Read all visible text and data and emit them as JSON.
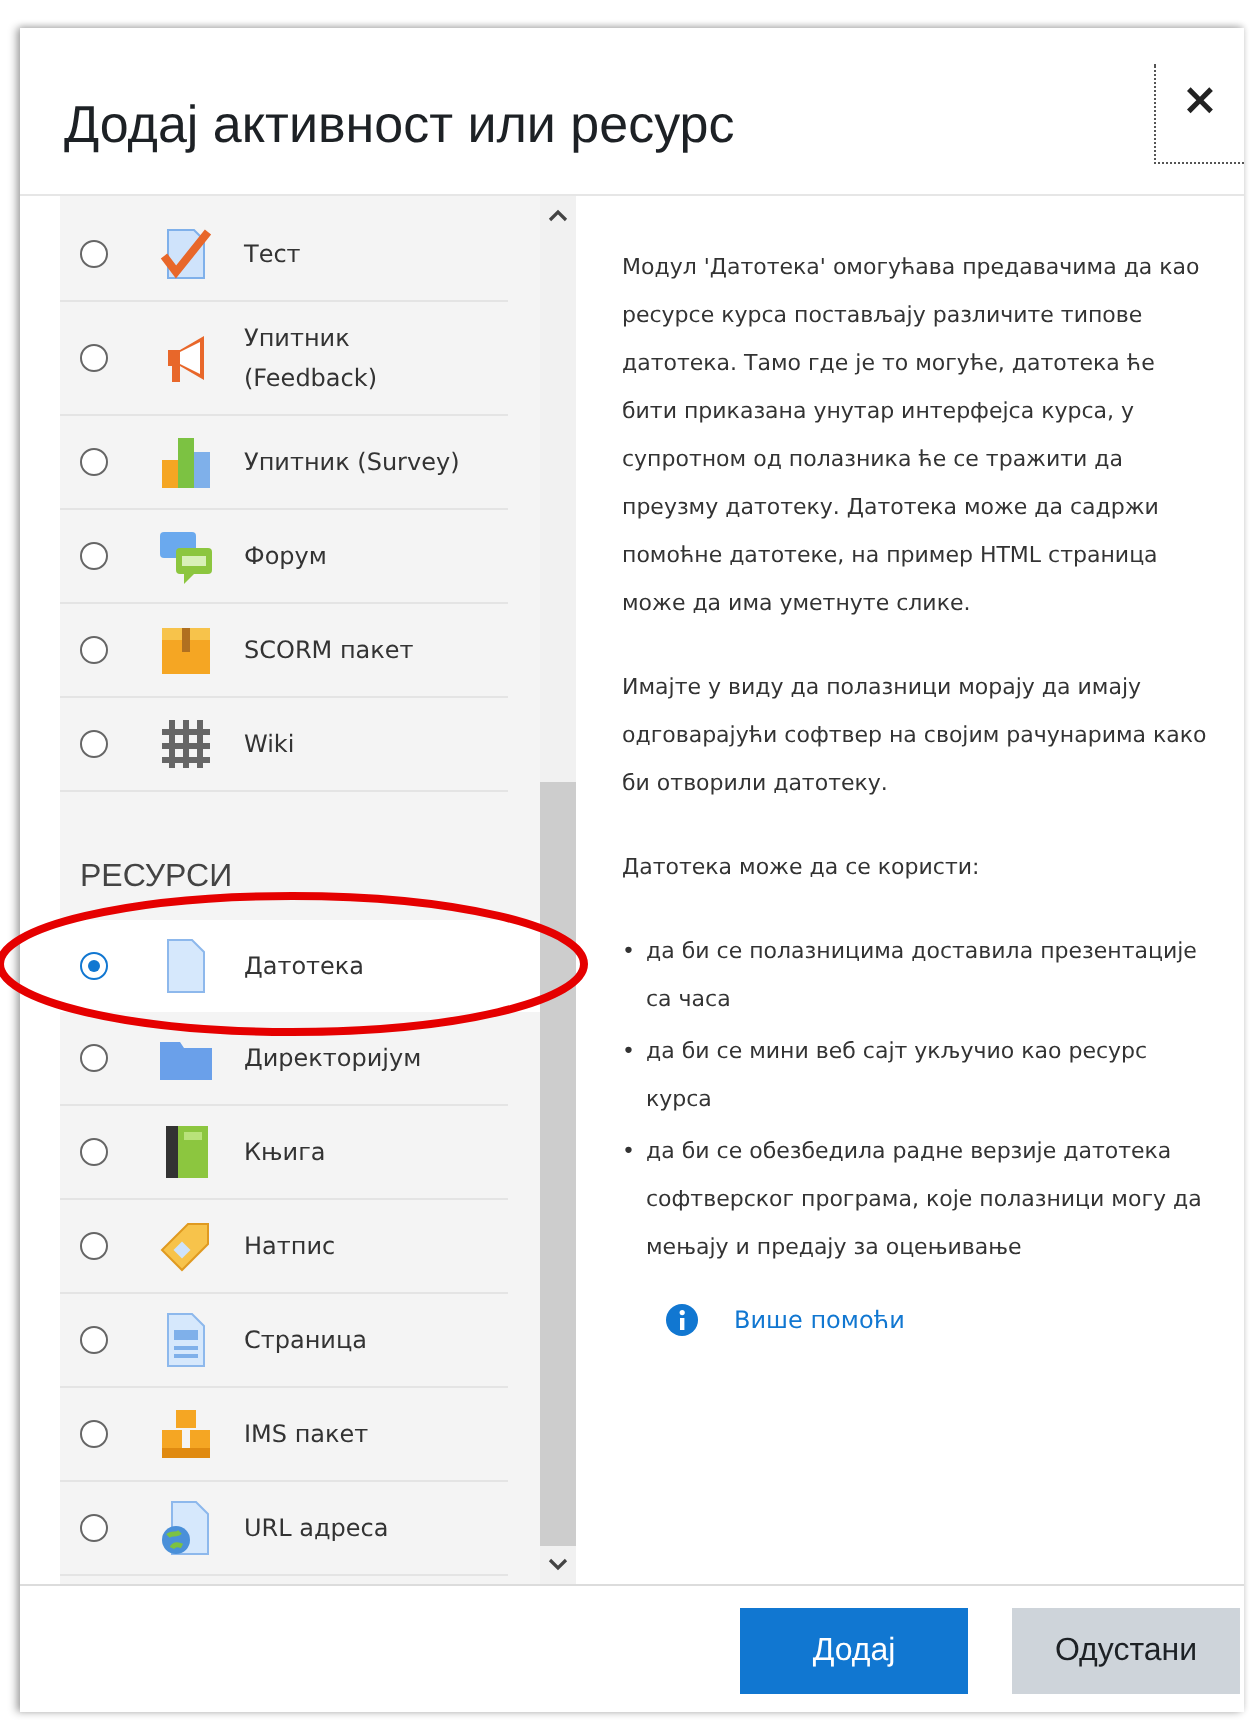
{
  "dialog": {
    "title": "Додај активност или ресурс",
    "close": "×"
  },
  "groups": [
    {
      "items": [
        {
          "label": "Тест",
          "selected": false
        },
        {
          "label": "Упитник (Feedback)",
          "selected": false
        },
        {
          "label": "Упитник (Survey)",
          "selected": false
        },
        {
          "label": "Форум",
          "selected": false
        },
        {
          "label": "SCORM пакет",
          "selected": false
        },
        {
          "label": "Wiki",
          "selected": false
        }
      ]
    },
    {
      "heading": "РЕСУРСИ",
      "items": [
        {
          "label": "Датотека",
          "selected": true
        },
        {
          "label": "Директоријум",
          "selected": false
        },
        {
          "label": "Књига",
          "selected": false
        },
        {
          "label": "Натпис",
          "selected": false
        },
        {
          "label": "Страница",
          "selected": false
        },
        {
          "label": "IMS пакет",
          "selected": false
        },
        {
          "label": "URL адреса",
          "selected": false
        }
      ]
    }
  ],
  "description": {
    "paragraphs": [
      "Модул 'Датотека' омогућава предавачима да као ресурсе курса постављају различите типове датотека. Тамо где је то могуће, датотека ће бити приказана унутар интерфејса курса, у супротном од полазника ће се тражити да преузму датотеку. Датотека може да садржи помоћне датотеке, на пример HTML страница може да има уметнуте слике.",
      "Имајте у виду да полазници морају да имају одговарајући софтвер на својим рачунарима како би отворили датотеку.",
      "Датотека може да се користи:"
    ],
    "bullets": [
      {
        "marker": "•",
        "text": "да би се полазницима доставила презентације са часа"
      },
      {
        "marker": "•",
        "text": "да би се мини веб сајт укључио као ресурс курса"
      },
      {
        "marker": "•",
        "text": "да би се обезбедила радне верзије датотека софтверског програма, које полазници могу да мењају и предају за оцењивање"
      }
    ],
    "help_link": "Више помоћи"
  },
  "buttons": [
    {
      "label": "Додај",
      "kind": "primary"
    },
    {
      "label": "Одустани",
      "kind": "secondary"
    }
  ]
}
